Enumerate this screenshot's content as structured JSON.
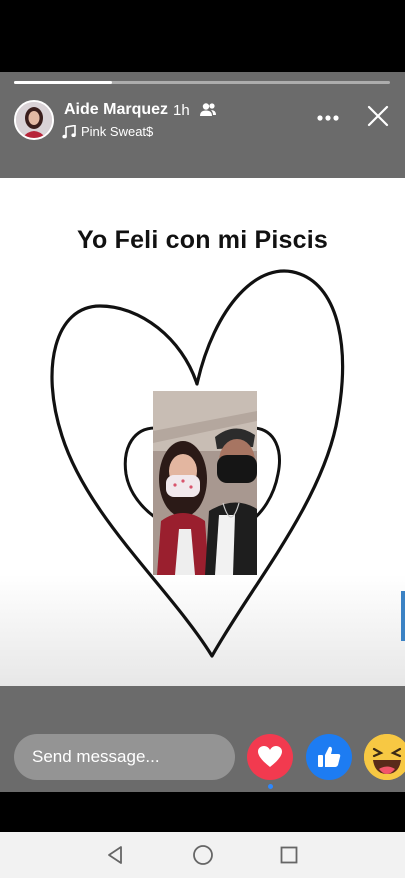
{
  "story": {
    "progress_fraction": 0.26,
    "author": {
      "name": "Aide Marquez",
      "time": "1h",
      "audience_icon": "friends-icon",
      "avatar_icon": "avatar"
    },
    "music": {
      "icon": "music-note-icon",
      "track": "Pink Sweat$"
    },
    "controls": {
      "more_icon": "more-dots-icon",
      "close_icon": "close-icon"
    },
    "content": {
      "caption": "Yo Feli con mi Piscis"
    }
  },
  "reply": {
    "placeholder": "Send message...",
    "reactions": [
      "love-heart-icon",
      "like-thumb-icon",
      "haha-emoji-icon"
    ],
    "colors": {
      "love": "#f23a4f",
      "like": "#1d7cf2",
      "haha": "#f7c843"
    }
  },
  "system_nav": [
    "back-icon",
    "home-icon",
    "recents-icon"
  ]
}
